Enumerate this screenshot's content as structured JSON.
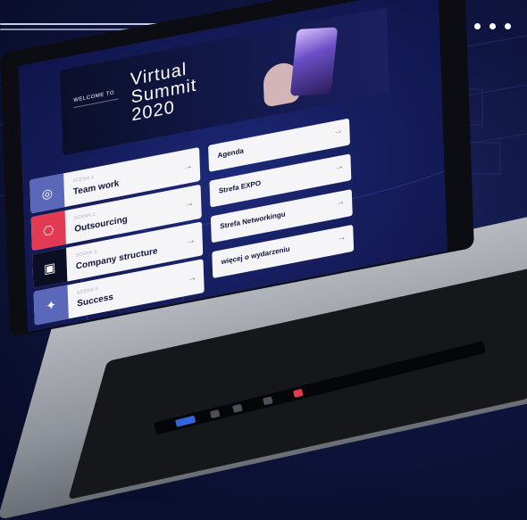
{
  "app": {
    "banner": {
      "welcome": "WELCOME TO",
      "title_line1": "Virtual",
      "title_line2": "Summit",
      "title_line3": "2020"
    },
    "stages": [
      {
        "stage_label": "SCENA 1",
        "name": "Team work",
        "icon": "team-icon",
        "color": "#5b67b9"
      },
      {
        "stage_label": "SCENA 2",
        "name": "Outsourcing",
        "icon": "outsourcing-icon",
        "color": "#e23a52"
      },
      {
        "stage_label": "SCENA 3",
        "name": "Company structure",
        "icon": "company-structure-icon",
        "color": "#0c0f24"
      },
      {
        "stage_label": "SCENA 4",
        "name": "Success",
        "icon": "success-icon",
        "color": "#5b67b9"
      }
    ],
    "right_cards": [
      {
        "label": "Agenda"
      },
      {
        "label": "Strefa EXPO"
      },
      {
        "label": "Strefa Networkingu"
      },
      {
        "label": "więcej o wydarzeniu"
      }
    ],
    "arrow": "→"
  },
  "decor": {
    "dots": [
      "•",
      "•",
      "•"
    ]
  },
  "colors": {
    "background": "#0c1030",
    "screen": "#151d5c",
    "card": "#f5f5f7",
    "accent": "#5b67b9",
    "red": "#e23a52"
  }
}
